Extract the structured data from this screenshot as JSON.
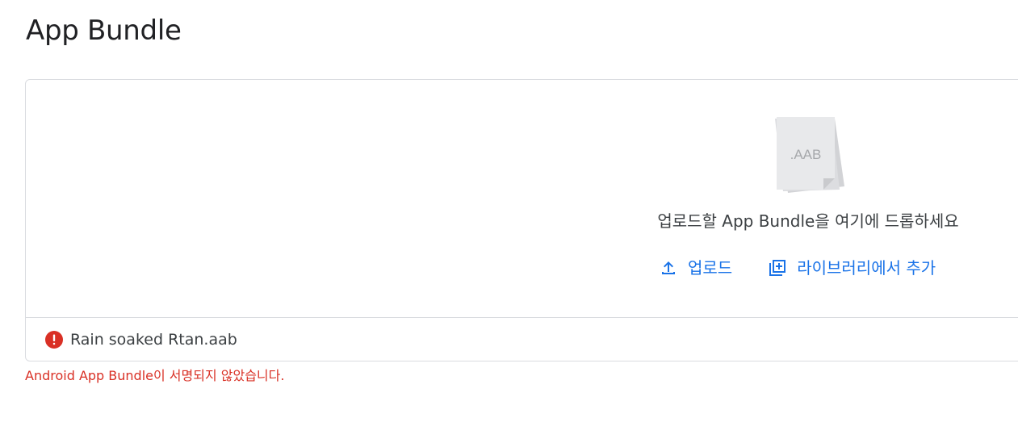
{
  "page": {
    "title": "App Bundle"
  },
  "dropzone": {
    "file_badge": ".AAB",
    "instruction": "업로드할 App Bundle을 여기에 드롭하세요",
    "upload_label": "업로드",
    "upload_icon": "upload-icon",
    "library_label": "라이브러리에서 추가",
    "library_icon": "library-add-icon"
  },
  "file": {
    "name": "Rain soaked Rtan.aab",
    "status_icon": "error-icon"
  },
  "error": {
    "message": "Android App Bundle이 서명되지 않았습니다."
  },
  "colors": {
    "accent": "#1a73e8",
    "error": "#d93025",
    "border": "#dadce0"
  }
}
